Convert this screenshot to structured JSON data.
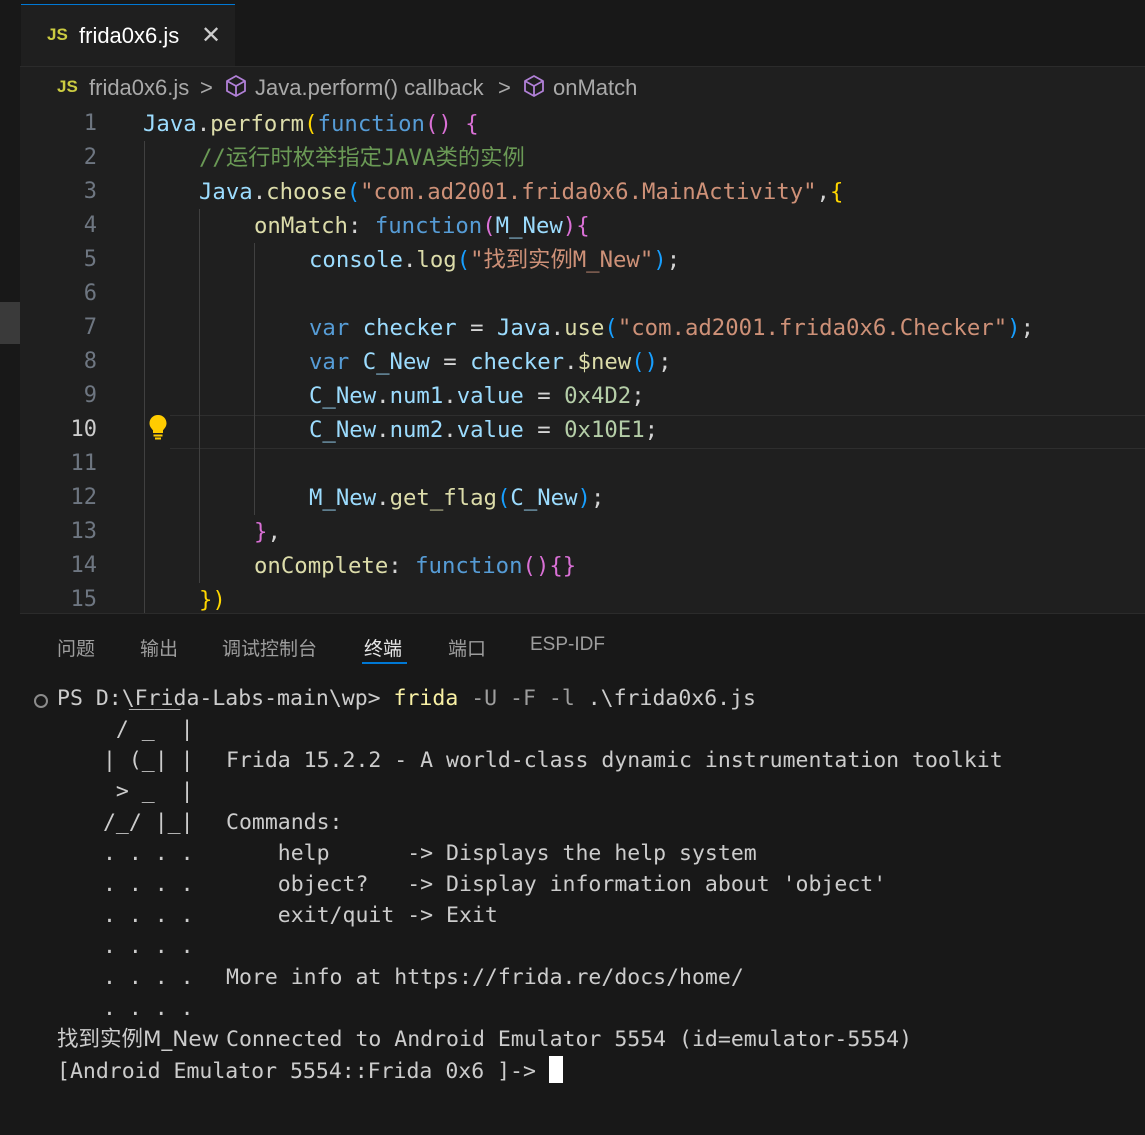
{
  "tab": {
    "badge": "JS",
    "title": "frida0x6.js",
    "close": "✕"
  },
  "breadcrumb": {
    "badge": "JS",
    "file": "frida0x6.js",
    "item1": "Java.perform() callback",
    "item2": "onMatch",
    "sep": ">"
  },
  "editor": {
    "active_line": 10,
    "lines": [
      {
        "n": "1"
      },
      {
        "n": "2"
      },
      {
        "n": "3"
      },
      {
        "n": "4"
      },
      {
        "n": "5"
      },
      {
        "n": "6"
      },
      {
        "n": "7"
      },
      {
        "n": "8"
      },
      {
        "n": "9"
      },
      {
        "n": "10"
      },
      {
        "n": "11"
      },
      {
        "n": "12"
      },
      {
        "n": "13"
      },
      {
        "n": "14"
      },
      {
        "n": "15"
      }
    ],
    "tokens": {
      "l1_java": "Java",
      "l1_dot": ".",
      "l1_perform": "perform",
      "l1_p1": "(",
      "l1_function": "function",
      "l1_p2": "()",
      "l1_brace": " {",
      "l2_comment": "//运行时枚举指定JAVA类的实例",
      "l3_java": "Java",
      "l3_dot": ".",
      "l3_choose": "choose",
      "l3_p1": "(",
      "l3_str": "\"com.ad2001.frida0x6.MainActivity\"",
      "l3_comma": ",",
      "l3_brace": "{",
      "l4_onmatch": "onMatch",
      "l4_colon": ": ",
      "l4_function": "function",
      "l4_p1": "(",
      "l4_arg": "M_New",
      "l4_p2": ")",
      "l4_brace": "{",
      "l5_console": "console",
      "l5_dot": ".",
      "l5_log": "log",
      "l5_p1": "(",
      "l5_str": "\"找到实例M_New\"",
      "l5_p2": ")",
      "l5_semi": ";",
      "l7_var": "var",
      "l7_name": " checker",
      "l7_eq": " = ",
      "l7_java": "Java",
      "l7_dot": ".",
      "l7_use": "use",
      "l7_p1": "(",
      "l7_str": "\"com.ad2001.frida0x6.Checker\"",
      "l7_p2": ")",
      "l7_semi": ";",
      "l8_var": "var",
      "l8_name": " C_New",
      "l8_eq": " = ",
      "l8_checker": "checker",
      "l8_dot": ".",
      "l8_new": "$new",
      "l8_p": "()",
      "l8_semi": ";",
      "l9_cnew": "C_New",
      "l9_d1": ".",
      "l9_num1": "num1",
      "l9_d2": ".",
      "l9_value": "value",
      "l9_eq": " = ",
      "l9_num": "0x4D2",
      "l9_semi": ";",
      "l10_cnew": "C_New",
      "l10_d1": ".",
      "l10_num2": "num2",
      "l10_d2": ".",
      "l10_value": "value",
      "l10_eq": " = ",
      "l10_num": "0x10E1",
      "l10_semi": ";",
      "l12_mnew": "M_New",
      "l12_dot": ".",
      "l12_getflag": "get_flag",
      "l12_p1": "(",
      "l12_arg": "C_New",
      "l12_p2": ")",
      "l12_semi": ";",
      "l13_brace": "}",
      "l13_comma": ",",
      "l14_oncomplete": "onComplete",
      "l14_colon": ": ",
      "l14_function": "function",
      "l14_p": "()",
      "l14_braces": "{}",
      "l15_close": "})"
    }
  },
  "panel": {
    "tabs": [
      "问题",
      "输出",
      "调试控制台",
      "终端",
      "端口",
      "ESP-IDF"
    ],
    "active_tab": "终端"
  },
  "terminal": {
    "prompt": "PS D:\\Frida-Labs-main\\wp> ",
    "cmd": "frida",
    "flags": " -U -F -l",
    "arg": " .\\frida0x6.js",
    "art": [
      "   ____",
      "  / _  |",
      " | (_| |",
      "  > _  |",
      " /_/ |_|",
      " . . . .",
      " . . . .",
      " . . . .",
      " . . . .",
      " . . . .",
      " . . . ."
    ],
    "info": [
      "Frida 15.2.2 - A world-class dynamic instrumentation toolkit",
      "",
      "Commands:",
      "    help      -> Displays the help system",
      "    object?   -> Display information about 'object'",
      "    exit/quit -> Exit",
      "",
      "More info at https://frida.re/docs/home/",
      "",
      "Connected to Android Emulator 5554 (id=emulator-5554)"
    ],
    "output": "找到实例M_New",
    "repl_prompt": "[Android Emulator 5554::Frida 0x6 ]-> "
  }
}
